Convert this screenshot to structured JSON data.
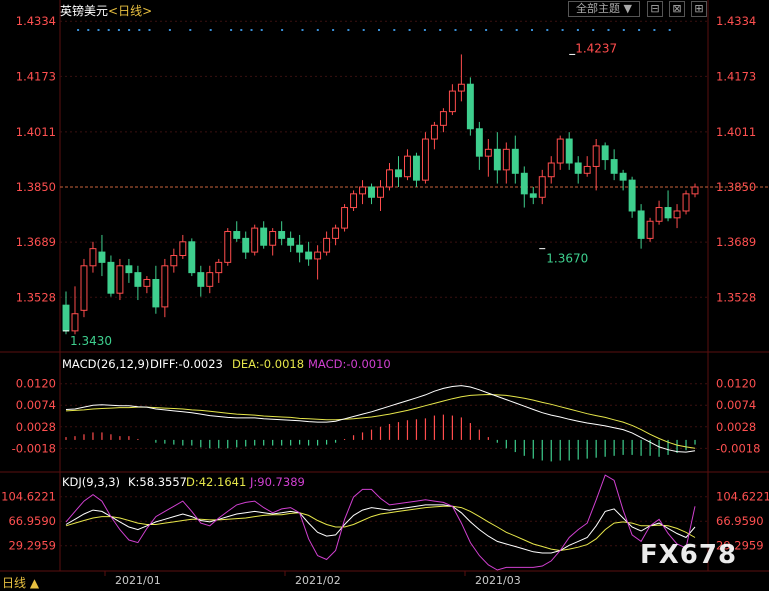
{
  "header": {
    "title": "英镑美元",
    "period": "<日线>",
    "theme_label": "全部主题",
    "theme_caret": "▼",
    "icon_a": "⊟",
    "icon_b": "⊠",
    "icon_c": "⊞"
  },
  "colors": {
    "up": "#ff4d4d",
    "down": "#3ecf8e",
    "price_axis": "#ff5050",
    "grid": "#3a1010",
    "diff": "#ffffff",
    "dea": "#e6e64a",
    "k": "#ffffff",
    "d": "#e6e64a",
    "j": "#d040d0",
    "dots": "#3a8fd6",
    "refline": "#c8643c"
  },
  "bottom_bar": {
    "period_label": "日线 ▲",
    "watermark": "FX678"
  },
  "chart_data": [
    {
      "type": "candlestick",
      "panel": "price",
      "title": "英镑美元<日线>",
      "y_ticks": [
        "1.4334",
        "1.4173",
        "1.4011",
        "1.3850",
        "1.3689",
        "1.3528"
      ],
      "ylim": [
        1.338,
        1.4355
      ],
      "x_tick_labels": [
        "2021/01",
        "2021/02",
        "2021/03"
      ],
      "x_tick_index": [
        5,
        34,
        63
      ],
      "reference_line": 1.385,
      "annotations": [
        {
          "text": "1.4237",
          "index": 56,
          "value": 1.4237,
          "kind": "high"
        },
        {
          "text": "1.3430",
          "index": 0,
          "value": 1.343,
          "kind": "low"
        },
        {
          "text": "1.3670",
          "index": 89,
          "value": 1.367,
          "kind": "low"
        }
      ],
      "dots_index": [
        1,
        3,
        5,
        7,
        9,
        11,
        13,
        15,
        19,
        23,
        27,
        31,
        33,
        35,
        37,
        41,
        45,
        48,
        51,
        54,
        57,
        60,
        63,
        66,
        69,
        72,
        75,
        78,
        81,
        84,
        87,
        90,
        93,
        96,
        99,
        102,
        105,
        108,
        111,
        114,
        117
      ],
      "candles": [
        {
          "o": 1.3505,
          "h": 1.3545,
          "l": 1.342,
          "c": 1.343
        },
        {
          "o": 1.343,
          "h": 1.356,
          "l": 1.342,
          "c": 1.348
        },
        {
          "o": 1.349,
          "h": 1.364,
          "l": 1.347,
          "c": 1.362
        },
        {
          "o": 1.362,
          "h": 1.369,
          "l": 1.36,
          "c": 1.367
        },
        {
          "o": 1.366,
          "h": 1.371,
          "l": 1.359,
          "c": 1.363
        },
        {
          "o": 1.363,
          "h": 1.365,
          "l": 1.353,
          "c": 1.354
        },
        {
          "o": 1.354,
          "h": 1.364,
          "l": 1.352,
          "c": 1.362
        },
        {
          "o": 1.362,
          "h": 1.364,
          "l": 1.357,
          "c": 1.36
        },
        {
          "o": 1.36,
          "h": 1.362,
          "l": 1.352,
          "c": 1.356
        },
        {
          "o": 1.356,
          "h": 1.359,
          "l": 1.354,
          "c": 1.358
        },
        {
          "o": 1.358,
          "h": 1.362,
          "l": 1.348,
          "c": 1.35
        },
        {
          "o": 1.35,
          "h": 1.364,
          "l": 1.347,
          "c": 1.362
        },
        {
          "o": 1.362,
          "h": 1.367,
          "l": 1.36,
          "c": 1.365
        },
        {
          "o": 1.365,
          "h": 1.371,
          "l": 1.364,
          "c": 1.369
        },
        {
          "o": 1.369,
          "h": 1.37,
          "l": 1.359,
          "c": 1.36
        },
        {
          "o": 1.36,
          "h": 1.362,
          "l": 1.353,
          "c": 1.356
        },
        {
          "o": 1.356,
          "h": 1.362,
          "l": 1.354,
          "c": 1.36
        },
        {
          "o": 1.36,
          "h": 1.364,
          "l": 1.357,
          "c": 1.363
        },
        {
          "o": 1.363,
          "h": 1.373,
          "l": 1.362,
          "c": 1.372
        },
        {
          "o": 1.372,
          "h": 1.375,
          "l": 1.369,
          "c": 1.37
        },
        {
          "o": 1.37,
          "h": 1.372,
          "l": 1.364,
          "c": 1.366
        },
        {
          "o": 1.366,
          "h": 1.374,
          "l": 1.365,
          "c": 1.373
        },
        {
          "o": 1.373,
          "h": 1.375,
          "l": 1.367,
          "c": 1.368
        },
        {
          "o": 1.368,
          "h": 1.373,
          "l": 1.365,
          "c": 1.372
        },
        {
          "o": 1.372,
          "h": 1.375,
          "l": 1.368,
          "c": 1.37
        },
        {
          "o": 1.37,
          "h": 1.372,
          "l": 1.366,
          "c": 1.368
        },
        {
          "o": 1.368,
          "h": 1.371,
          "l": 1.363,
          "c": 1.366
        },
        {
          "o": 1.366,
          "h": 1.369,
          "l": 1.362,
          "c": 1.364
        },
        {
          "o": 1.364,
          "h": 1.368,
          "l": 1.358,
          "c": 1.366
        },
        {
          "o": 1.366,
          "h": 1.372,
          "l": 1.365,
          "c": 1.37
        },
        {
          "o": 1.37,
          "h": 1.374,
          "l": 1.368,
          "c": 1.373
        },
        {
          "o": 1.373,
          "h": 1.38,
          "l": 1.372,
          "c": 1.379
        },
        {
          "o": 1.379,
          "h": 1.384,
          "l": 1.378,
          "c": 1.383
        },
        {
          "o": 1.383,
          "h": 1.387,
          "l": 1.38,
          "c": 1.385
        },
        {
          "o": 1.385,
          "h": 1.386,
          "l": 1.38,
          "c": 1.382
        },
        {
          "o": 1.382,
          "h": 1.387,
          "l": 1.378,
          "c": 1.385
        },
        {
          "o": 1.385,
          "h": 1.392,
          "l": 1.384,
          "c": 1.39
        },
        {
          "o": 1.39,
          "h": 1.394,
          "l": 1.385,
          "c": 1.388
        },
        {
          "o": 1.388,
          "h": 1.396,
          "l": 1.387,
          "c": 1.394
        },
        {
          "o": 1.394,
          "h": 1.395,
          "l": 1.385,
          "c": 1.387
        },
        {
          "o": 1.387,
          "h": 1.401,
          "l": 1.386,
          "c": 1.399
        },
        {
          "o": 1.399,
          "h": 1.404,
          "l": 1.396,
          "c": 1.403
        },
        {
          "o": 1.403,
          "h": 1.408,
          "l": 1.401,
          "c": 1.407
        },
        {
          "o": 1.407,
          "h": 1.415,
          "l": 1.406,
          "c": 1.413
        },
        {
          "o": 1.413,
          "h": 1.4237,
          "l": 1.41,
          "c": 1.415
        },
        {
          "o": 1.415,
          "h": 1.417,
          "l": 1.4,
          "c": 1.402
        },
        {
          "o": 1.402,
          "h": 1.404,
          "l": 1.39,
          "c": 1.394
        },
        {
          "o": 1.394,
          "h": 1.399,
          "l": 1.388,
          "c": 1.396
        },
        {
          "o": 1.396,
          "h": 1.401,
          "l": 1.386,
          "c": 1.39
        },
        {
          "o": 1.39,
          "h": 1.398,
          "l": 1.386,
          "c": 1.396
        },
        {
          "o": 1.396,
          "h": 1.4,
          "l": 1.386,
          "c": 1.389
        },
        {
          "o": 1.389,
          "h": 1.391,
          "l": 1.379,
          "c": 1.383
        },
        {
          "o": 1.383,
          "h": 1.385,
          "l": 1.38,
          "c": 1.382
        },
        {
          "o": 1.382,
          "h": 1.39,
          "l": 1.38,
          "c": 1.388
        },
        {
          "o": 1.388,
          "h": 1.394,
          "l": 1.386,
          "c": 1.392
        },
        {
          "o": 1.392,
          "h": 1.4,
          "l": 1.39,
          "c": 1.399
        },
        {
          "o": 1.399,
          "h": 1.401,
          "l": 1.39,
          "c": 1.392
        },
        {
          "o": 1.392,
          "h": 1.394,
          "l": 1.386,
          "c": 1.389
        },
        {
          "o": 1.389,
          "h": 1.394,
          "l": 1.388,
          "c": 1.391
        },
        {
          "o": 1.391,
          "h": 1.399,
          "l": 1.384,
          "c": 1.397
        },
        {
          "o": 1.397,
          "h": 1.398,
          "l": 1.39,
          "c": 1.393
        },
        {
          "o": 1.393,
          "h": 1.396,
          "l": 1.387,
          "c": 1.389
        },
        {
          "o": 1.389,
          "h": 1.39,
          "l": 1.384,
          "c": 1.387
        },
        {
          "o": 1.387,
          "h": 1.388,
          "l": 1.376,
          "c": 1.378
        },
        {
          "o": 1.378,
          "h": 1.38,
          "l": 1.367,
          "c": 1.37
        },
        {
          "o": 1.37,
          "h": 1.376,
          "l": 1.369,
          "c": 1.375
        },
        {
          "o": 1.375,
          "h": 1.381,
          "l": 1.374,
          "c": 1.379
        },
        {
          "o": 1.379,
          "h": 1.384,
          "l": 1.375,
          "c": 1.376
        },
        {
          "o": 1.376,
          "h": 1.38,
          "l": 1.373,
          "c": 1.378
        },
        {
          "o": 1.378,
          "h": 1.384,
          "l": 1.377,
          "c": 1.383
        },
        {
          "o": 1.383,
          "h": 1.386,
          "l": 1.382,
          "c": 1.385
        }
      ]
    },
    {
      "type": "line",
      "panel": "macd",
      "title": "MACD(26,12,9)",
      "legend": [
        {
          "name": "DIFF",
          "text": "DIFF:-0.0023"
        },
        {
          "name": "DEA",
          "text": "DEA:-0.0018"
        },
        {
          "name": "MACD",
          "text": "MACD:-0.0010"
        }
      ],
      "y_ticks": [
        "0.0120",
        "0.0074",
        "0.0028",
        "-0.0018"
      ],
      "ylim": [
        -0.006,
        0.0145
      ],
      "diff": [
        0.0065,
        0.0066,
        0.007,
        0.0074,
        0.0075,
        0.0074,
        0.0073,
        0.0073,
        0.0071,
        0.007,
        0.0066,
        0.0064,
        0.0062,
        0.006,
        0.0058,
        0.0055,
        0.0052,
        0.005,
        0.0048,
        0.0047,
        0.0047,
        0.0047,
        0.0045,
        0.0044,
        0.0043,
        0.0042,
        0.0041,
        0.0039,
        0.0038,
        0.0038,
        0.004,
        0.0045,
        0.005,
        0.0055,
        0.006,
        0.0066,
        0.0072,
        0.0078,
        0.0084,
        0.009,
        0.0096,
        0.0104,
        0.011,
        0.0114,
        0.0116,
        0.0113,
        0.0107,
        0.01,
        0.0093,
        0.0086,
        0.0079,
        0.0072,
        0.0065,
        0.0058,
        0.0053,
        0.0049,
        0.0044,
        0.004,
        0.0036,
        0.0033,
        0.003,
        0.0026,
        0.0022,
        0.0015,
        0.0005,
        -0.0005,
        -0.0015,
        -0.0021,
        -0.0025,
        -0.0026,
        -0.0023
      ],
      "dea": [
        0.0062,
        0.0063,
        0.0064,
        0.0066,
        0.0067,
        0.0068,
        0.0069,
        0.0069,
        0.007,
        0.007,
        0.0069,
        0.0068,
        0.0067,
        0.0066,
        0.0064,
        0.0063,
        0.0061,
        0.0059,
        0.0057,
        0.0055,
        0.0054,
        0.0053,
        0.0051,
        0.005,
        0.0049,
        0.0048,
        0.0046,
        0.0045,
        0.0044,
        0.0043,
        0.0043,
        0.0044,
        0.0045,
        0.0047,
        0.0049,
        0.0052,
        0.0055,
        0.0059,
        0.0063,
        0.0068,
        0.0073,
        0.0078,
        0.0083,
        0.0088,
        0.0092,
        0.0095,
        0.0096,
        0.0097,
        0.0096,
        0.0095,
        0.0092,
        0.0089,
        0.0085,
        0.008,
        0.0076,
        0.0071,
        0.0066,
        0.0061,
        0.0056,
        0.0052,
        0.0048,
        0.0043,
        0.0038,
        0.0031,
        0.0022,
        0.0012,
        0.0003,
        -0.0005,
        -0.0011,
        -0.0015,
        -0.0018
      ],
      "macd": [
        0.0006,
        0.0008,
        0.0012,
        0.0016,
        0.0016,
        0.0012,
        0.0008,
        0.0008,
        0.0002,
        0.0,
        -0.0006,
        -0.0008,
        -0.001,
        -0.0012,
        -0.0012,
        -0.0016,
        -0.0018,
        -0.0018,
        -0.0018,
        -0.0016,
        -0.0014,
        -0.0012,
        -0.0012,
        -0.0012,
        -0.0012,
        -0.0012,
        -0.001,
        -0.0012,
        -0.0012,
        -0.001,
        -0.0006,
        0.0002,
        0.001,
        0.0016,
        0.0022,
        0.0028,
        0.0034,
        0.0038,
        0.0042,
        0.0044,
        0.0046,
        0.0052,
        0.0054,
        0.0052,
        0.0048,
        0.0036,
        0.0022,
        0.0006,
        -0.0006,
        -0.0018,
        -0.0026,
        -0.0034,
        -0.004,
        -0.0044,
        -0.0046,
        -0.0044,
        -0.0044,
        -0.0042,
        -0.004,
        -0.0038,
        -0.0036,
        -0.0034,
        -0.0032,
        -0.0032,
        -0.0034,
        -0.0034,
        -0.0036,
        -0.0032,
        -0.0028,
        -0.0022,
        -0.001
      ]
    },
    {
      "type": "line",
      "panel": "kdj",
      "title": "KDJ(9,3,3)",
      "legend": [
        {
          "name": "K",
          "text": "K:58.3557"
        },
        {
          "name": "D",
          "text": "D:42.1641"
        },
        {
          "name": "J",
          "text": "J:90.7389"
        }
      ],
      "y_ticks": [
        "104.6221",
        "66.9590",
        "29.2959"
      ],
      "ylim": [
        -5,
        115
      ],
      "k": [
        62,
        70,
        78,
        84,
        82,
        74,
        66,
        58,
        54,
        60,
        66,
        70,
        74,
        78,
        74,
        68,
        66,
        70,
        74,
        78,
        80,
        82,
        80,
        78,
        80,
        82,
        80,
        64,
        50,
        44,
        46,
        62,
        76,
        84,
        88,
        86,
        84,
        86,
        88,
        90,
        92,
        92,
        92,
        90,
        80,
        66,
        54,
        44,
        36,
        32,
        28,
        24,
        20,
        18,
        18,
        22,
        30,
        36,
        42,
        60,
        82,
        86,
        72,
        58,
        52,
        60,
        64,
        56,
        48,
        42,
        58
      ],
      "d": [
        60,
        64,
        68,
        72,
        74,
        74,
        72,
        68,
        64,
        62,
        62,
        64,
        66,
        68,
        70,
        70,
        69,
        69,
        70,
        71,
        72,
        74,
        76,
        77,
        77,
        79,
        80,
        76,
        68,
        62,
        58,
        58,
        62,
        68,
        74,
        78,
        80,
        82,
        84,
        86,
        88,
        89,
        90,
        90,
        88,
        82,
        74,
        66,
        58,
        50,
        44,
        38,
        32,
        28,
        24,
        22,
        24,
        27,
        31,
        40,
        54,
        64,
        66,
        64,
        60,
        60,
        61,
        60,
        56,
        50,
        42
      ],
      "j": [
        66,
        82,
        98,
        108,
        98,
        74,
        54,
        38,
        34,
        56,
        74,
        82,
        90,
        98,
        82,
        64,
        60,
        72,
        82,
        92,
        96,
        98,
        88,
        80,
        86,
        88,
        80,
        40,
        14,
        8,
        22,
        70,
        104,
        116,
        116,
        102,
        92,
        94,
        96,
        98,
        100,
        98,
        96,
        90,
        64,
        34,
        14,
        0,
        -8,
        -4,
        -4,
        -4,
        -4,
        -2,
        6,
        22,
        42,
        54,
        64,
        100,
        138,
        130,
        84,
        46,
        36,
        60,
        70,
        48,
        32,
        26,
        90
      ]
    }
  ]
}
